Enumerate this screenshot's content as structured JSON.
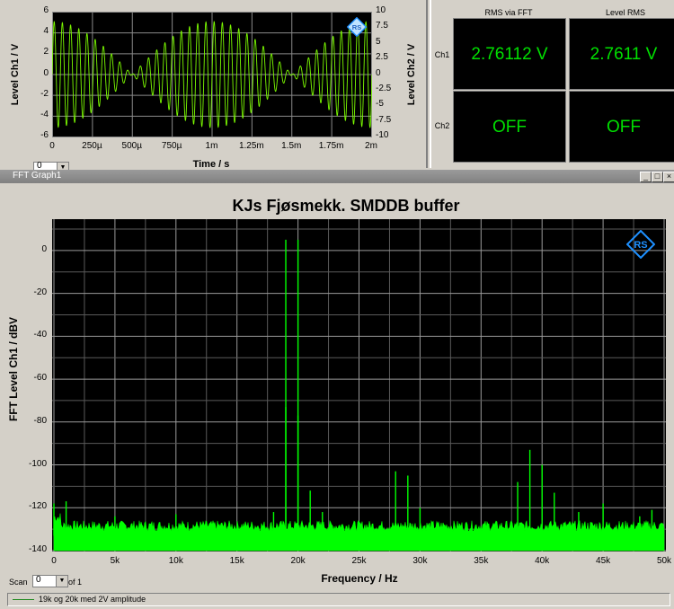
{
  "top_graph": {
    "y_left_label": "Level Ch1 / V",
    "y_right_label": "Level Ch2 / V",
    "x_label": "Time / s",
    "y_left_ticks": [
      "6",
      "4",
      "2",
      "0",
      "-2",
      "-4",
      "-6"
    ],
    "y_right_ticks": [
      "10",
      "7.5",
      "5",
      "2.5",
      "0",
      "-2.5",
      "-5",
      "-7.5",
      "-10"
    ],
    "x_ticks": [
      "0",
      "250µ",
      "500µ",
      "750µ",
      "1m",
      "1.25m",
      "1.5m",
      "1.75m",
      "2m"
    ],
    "scan_value": "0",
    "trace_color": "#7cfc00"
  },
  "meters": {
    "col1_header": "RMS via FFT",
    "col2_header": "Level RMS",
    "row1_label": "Ch1",
    "row2_label": "Ch2",
    "ch1_fft": "2.76112 V",
    "ch1_rms": "2.7611 V",
    "ch2_fft": "OFF",
    "ch2_rms": "OFF"
  },
  "fft_window": {
    "title": "FFT Graph1",
    "buttons": [
      "_",
      "□",
      "×"
    ]
  },
  "fft_graph": {
    "title": "KJs Fjøsmekk. SMDDB buffer",
    "x_label": "Frequency / Hz",
    "y_label": "FFT Level Ch1 / dBV",
    "scan_label": "Scan",
    "scan_value": "0",
    "of_label": "of 1",
    "legend_text": "19k og 20k med 2V amplitude"
  },
  "chart_data": {
    "type": "line",
    "title": "KJs Fjøsmekk. SMDDB buffer",
    "xlabel": "Frequency / Hz",
    "ylabel": "FFT Level Ch1 / dBV",
    "xlim": [
      0,
      50000
    ],
    "ylim": [
      -140,
      10
    ],
    "x_ticks": [
      "0",
      "5k",
      "10k",
      "15k",
      "20k",
      "25k",
      "30k",
      "35k",
      "40k",
      "45k",
      "50k"
    ],
    "y_ticks": [
      "0",
      "-20",
      "-40",
      "-60",
      "-80",
      "-100",
      "-120",
      "-140"
    ],
    "grid": true,
    "line_color": "#00ff00",
    "noise_floor_dbv": -133,
    "series": [
      {
        "name": "19k og 20k med 2V amplitude",
        "peaks": [
          {
            "x": 0,
            "y": -118
          },
          {
            "x": 1000,
            "y": -117
          },
          {
            "x": 5000,
            "y": -124
          },
          {
            "x": 10000,
            "y": -123
          },
          {
            "x": 18000,
            "y": -122
          },
          {
            "x": 19000,
            "y": 5
          },
          {
            "x": 19000,
            "y": -73
          },
          {
            "x": 20000,
            "y": 5
          },
          {
            "x": 20000,
            "y": -77
          },
          {
            "x": 21000,
            "y": -112
          },
          {
            "x": 22000,
            "y": -122
          },
          {
            "x": 28000,
            "y": -103
          },
          {
            "x": 29000,
            "y": -105
          },
          {
            "x": 30000,
            "y": -120
          },
          {
            "x": 38000,
            "y": -108
          },
          {
            "x": 39000,
            "y": -93
          },
          {
            "x": 40000,
            "y": -100
          },
          {
            "x": 41000,
            "y": -113
          },
          {
            "x": 43000,
            "y": -122
          },
          {
            "x": 45000,
            "y": -118
          },
          {
            "x": 47000,
            "y": -128
          },
          {
            "x": 48000,
            "y": -124
          },
          {
            "x": 49000,
            "y": -121
          }
        ]
      }
    ]
  }
}
